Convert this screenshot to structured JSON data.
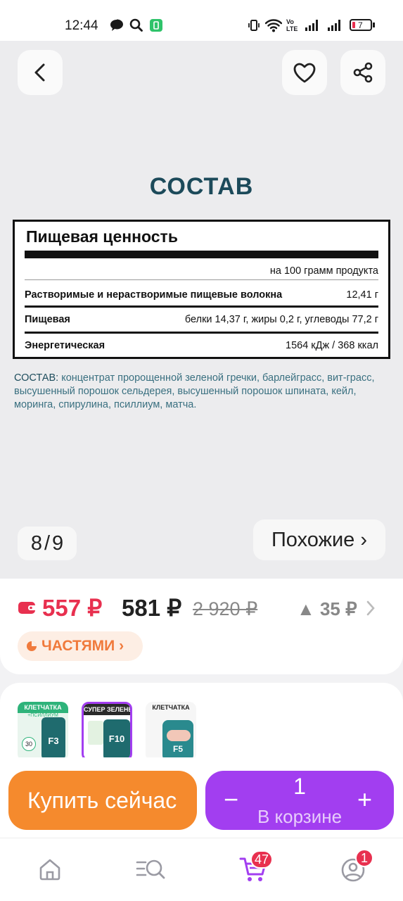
{
  "status_bar": {
    "time": "12:44",
    "battery": "7",
    "network": "Vo LTE"
  },
  "gallery": {
    "title": "СОСТАВ",
    "nutrition": {
      "heading": "Пищевая ценность",
      "per": "на 100 грамм продукта",
      "rows": [
        {
          "label": "Растворимые и нерастворимые пищевые волокна",
          "value": "12,41 г"
        },
        {
          "label": "Пищевая",
          "value": "белки 14,37 г, жиры 0,2 г, углеводы 77,2 г"
        },
        {
          "label": "Энергетическая",
          "value": "1564 кДж / 368 ккал"
        }
      ]
    },
    "composition_label": "СОСТАВ:",
    "composition_text": " концентрат пророщенной зеленой гречки, барлейграсс, вит-грасс, высушенный порошок сельдерея, высушенный порошок шпината, кейл, моринга, спирулина, псиллиум, матча.",
    "counter_current": "8",
    "counter_sep": "/",
    "counter_total": "9",
    "similar_label": "Похожие ›"
  },
  "price": {
    "wallet_price": "557 ₽",
    "current_price": "581 ₽",
    "old_price": "2 920 ₽",
    "price_change": "▲ 35 ₽",
    "parts_label": "ЧАСТЯМИ ›"
  },
  "variants": [
    {
      "line1": "КЛЕТЧАТКА",
      "line2": "+ПСИЛЛИУМ",
      "code": "F3",
      "sub": "MULTIFIBER",
      "badge": "30"
    },
    {
      "line1": "СУПЕР ЗЕЛЕНЬ",
      "line2": "",
      "code": "F10",
      "sub": "MULTIFIBER",
      "badge": ""
    },
    {
      "line1": "КЛЕТЧАТКА",
      "line2": "",
      "code": "F5",
      "sub": "",
      "badge": ""
    }
  ],
  "actions": {
    "buy_now": "Купить сейчас",
    "quantity": "1",
    "in_cart": "В корзине",
    "minus": "−",
    "plus": "+"
  },
  "tabbar": {
    "cart_badge": "47",
    "profile_badge": "1"
  },
  "colors": {
    "accent_purple": "#a23ef0",
    "accent_orange": "#f58a2d",
    "price_red": "#e8304f",
    "title_teal": "#1c4a5a"
  }
}
